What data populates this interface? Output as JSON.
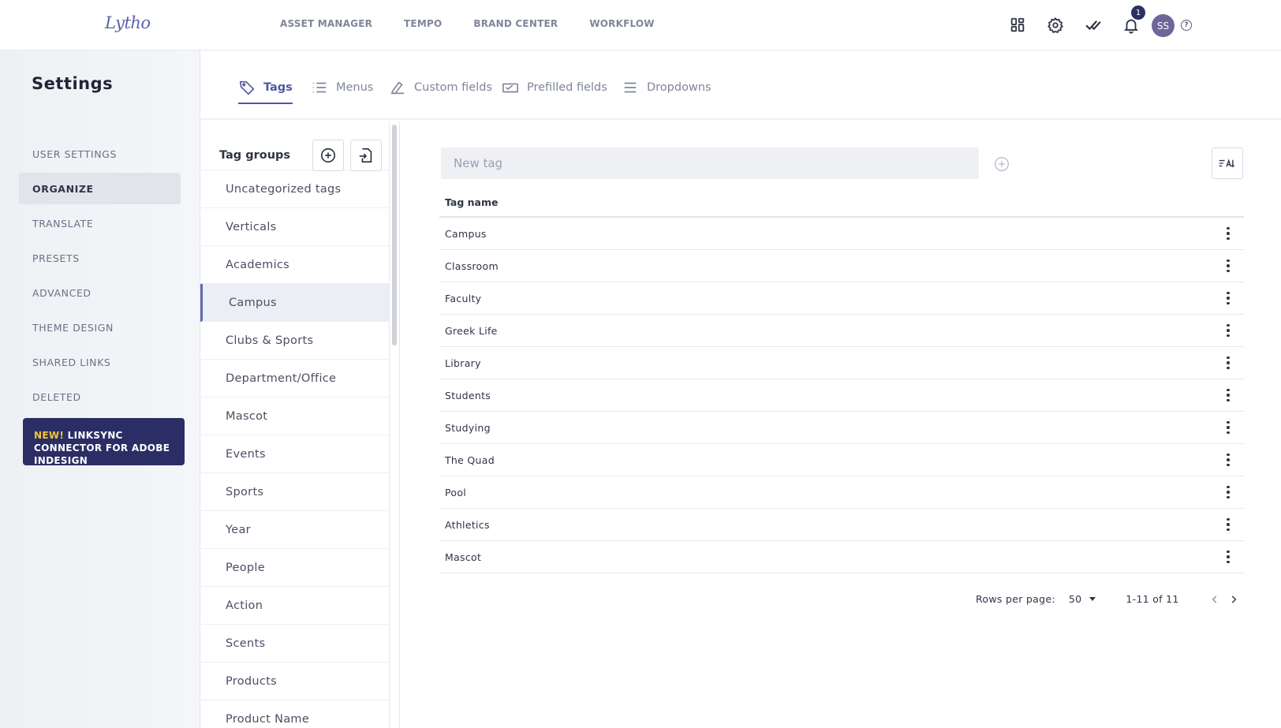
{
  "app": {
    "logo": "Lytho"
  },
  "topnav": [
    "ASSET MANAGER",
    "TEMPO",
    "BRAND CENTER",
    "WORKFLOW"
  ],
  "header": {
    "notifications_count": "1",
    "avatar_initials": "SS",
    "help": "?"
  },
  "sidebar": {
    "title": "Settings",
    "items": [
      {
        "label": "USER SETTINGS",
        "active": false
      },
      {
        "label": "ORGANIZE",
        "active": true
      },
      {
        "label": "TRANSLATE",
        "active": false
      },
      {
        "label": "PRESETS",
        "active": false
      },
      {
        "label": "ADVANCED",
        "active": false
      },
      {
        "label": "THEME DESIGN",
        "active": false
      },
      {
        "label": "SHARED LINKS",
        "active": false
      },
      {
        "label": "DELETED",
        "active": false
      }
    ],
    "promo": {
      "new": "NEW!",
      "text": " LINKSYNC CONNECTOR FOR ADOBE INDESIGN"
    }
  },
  "tabs": [
    {
      "label": "Tags",
      "icon": "tag-icon",
      "active": true
    },
    {
      "label": "Menus",
      "icon": "list-icon",
      "active": false
    },
    {
      "label": "Custom fields",
      "icon": "custom-field-icon",
      "active": false
    },
    {
      "label": "Prefilled fields",
      "icon": "prefilled-field-icon",
      "active": false
    },
    {
      "label": "Dropdowns",
      "icon": "dropdown-icon",
      "active": false
    }
  ],
  "tag_groups": {
    "title": "Tag groups",
    "items": [
      {
        "label": "Uncategorized tags",
        "active": false
      },
      {
        "label": "Verticals",
        "active": false
      },
      {
        "label": "Academics",
        "active": false
      },
      {
        "label": "Campus",
        "active": true
      },
      {
        "label": "Clubs & Sports",
        "active": false
      },
      {
        "label": "Department/Office",
        "active": false
      },
      {
        "label": "Mascot",
        "active": false
      },
      {
        "label": "Events",
        "active": false
      },
      {
        "label": "Sports",
        "active": false
      },
      {
        "label": "Year",
        "active": false
      },
      {
        "label": "People",
        "active": false
      },
      {
        "label": "Action",
        "active": false
      },
      {
        "label": "Scents",
        "active": false
      },
      {
        "label": "Products",
        "active": false
      },
      {
        "label": "Product Name",
        "active": false
      }
    ]
  },
  "tags": {
    "new_tag_placeholder": "New tag",
    "column_header": "Tag name",
    "rows": [
      "Campus",
      "Classroom",
      "Faculty",
      "Greek Life",
      "Library",
      "Students",
      "Studying",
      "The Quad",
      "Pool",
      "Athletics",
      "Mascot"
    ],
    "pagination": {
      "rows_per_page_label": "Rows per page:",
      "rows_per_page_value": "50",
      "range": "1-11 of 11"
    }
  },
  "colors": {
    "accent": "#4f58a5",
    "promo_bg": "#2b2e64",
    "promo_new": "#f3c431",
    "badge_bg": "#2b3162",
    "avatar_bg": "#6e6699"
  }
}
